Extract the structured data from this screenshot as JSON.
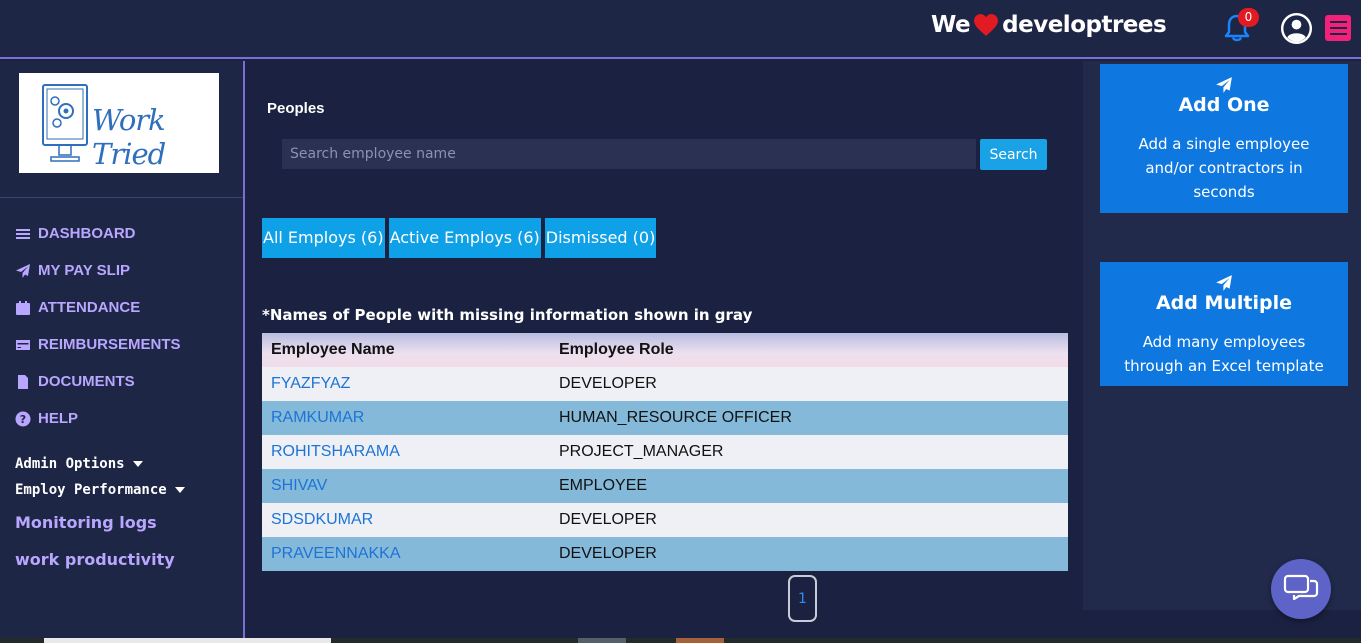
{
  "header": {
    "brand_prefix": "We",
    "brand_suffix": "developtrees",
    "notification_count": "0"
  },
  "sidebar": {
    "logo_text": "Work Tried",
    "items": [
      {
        "label": "DASHBOARD",
        "icon": "bars-icon"
      },
      {
        "label": "MY PAY SLIP",
        "icon": "paper-plane-icon"
      },
      {
        "label": "ATTENDANCE",
        "icon": "calendar-icon"
      },
      {
        "label": "REIMBURSEMENTS",
        "icon": "credit-card-icon"
      },
      {
        "label": "DOCUMENTS",
        "icon": "file-icon"
      },
      {
        "label": "HELP",
        "icon": "question-circle-icon"
      }
    ],
    "dropdowns": [
      "Admin Options",
      "Employ Performance"
    ],
    "links": [
      "Monitoring logs",
      "work productivity"
    ]
  },
  "main": {
    "title": "Peoples",
    "search": {
      "placeholder": "Search employee name",
      "button_label": "Search"
    },
    "tabs": [
      "All Employs (6)",
      "Active Employs (6)",
      "Dismissed (0)"
    ],
    "note": "*Names of People with missing information shown in gray",
    "table": {
      "columns": [
        "Employee Name",
        "Employee Role"
      ],
      "rows": [
        [
          "FYAZFYAZ",
          "DEVELOPER"
        ],
        [
          "RAMKUMAR",
          "HUMAN_RESOURCE OFFICER"
        ],
        [
          "ROHITSHARAMA",
          "PROJECT_MANAGER"
        ],
        [
          "SHIVAV",
          "EMPLOYEE"
        ],
        [
          "SDSDKUMAR",
          "DEVELOPER"
        ],
        [
          "PRAVEENNAKKA",
          "DEVELOPER"
        ]
      ]
    },
    "pagination": {
      "current_page": "1"
    }
  },
  "right_panel": {
    "cards": [
      {
        "title": "Add One",
        "description": "Add a single employee and/or contractors in seconds"
      },
      {
        "title": "Add Multiple",
        "description": "Add many employees through an Excel template"
      }
    ]
  },
  "colors": {
    "background": "#1b2140",
    "accent": "#0fa1e7",
    "nav_text": "#b9a6ff",
    "card": "#0e78e0",
    "badge": "#e21b23"
  }
}
